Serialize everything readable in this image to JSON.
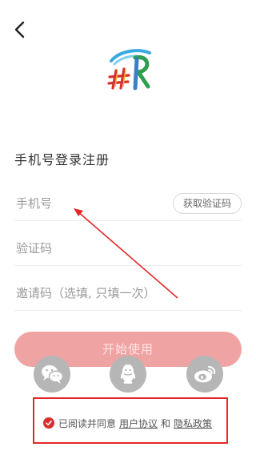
{
  "icons": {
    "back": "chevron-left-icon",
    "logo": "app-logo",
    "wechat": "wechat-icon",
    "qq": "qq-icon",
    "weibo": "weibo-icon",
    "check": "check-circle-icon"
  },
  "login": {
    "title": "手机号登录注册",
    "phone_placeholder": "手机号",
    "get_code_label": "获取验证码",
    "code_placeholder": "验证码",
    "invite_placeholder": "邀请码（选填, 只填一次）",
    "start_label": "开始使用"
  },
  "agreement": {
    "prefix": "已阅读并同意",
    "user_agreement": "用户协议",
    "and": "和",
    "privacy_policy": "隐私政策"
  },
  "colors": {
    "start_button": "#efa3a3",
    "social_button": "#b6b6b6",
    "annotation": "#e32828"
  }
}
